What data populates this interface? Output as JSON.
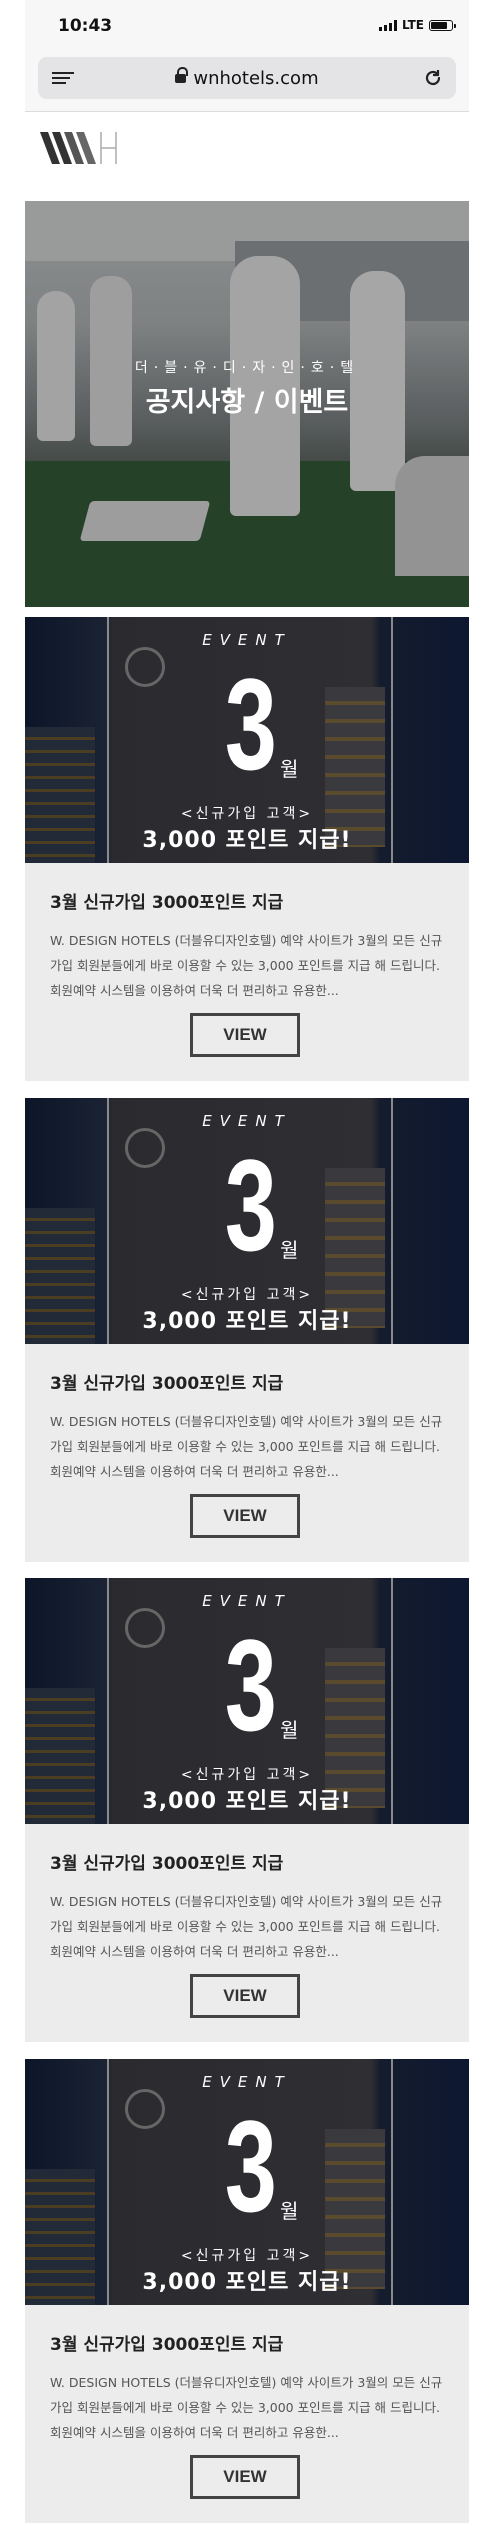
{
  "status_bar": {
    "time": "10:43",
    "network": "LTE"
  },
  "browser": {
    "url": "wnhotels.com"
  },
  "hero": {
    "subtitle": "더·블·유·디·자·인·호·텔",
    "title": "공지사항 / 이벤트"
  },
  "cards": [
    {
      "banner_event": "EVENT",
      "banner_number": "3",
      "banner_month": "월",
      "banner_sub": "<신규가입 고객>",
      "banner_main": "3,000 포인트 지급!",
      "title": "3월 신규가입 3000포인트 지급",
      "description": "W. DESIGN HOTELS (더블유디자인호텔) 예약 사이트가 3월의 모든 신규가입 회원분들에게 바로 이용할 수 있는 3,000 포인트를 지급 해 드립니다. 회원예약 시스템을 이용하여 더욱 더 편리하고 유용한...",
      "button": "VIEW"
    },
    {
      "banner_event": "EVENT",
      "banner_number": "3",
      "banner_month": "월",
      "banner_sub": "<신규가입 고객>",
      "banner_main": "3,000 포인트 지급!",
      "title": "3월 신규가입 3000포인트 지급",
      "description": "W. DESIGN HOTELS (더블유디자인호텔) 예약 사이트가 3월의 모든 신규가입 회원분들에게 바로 이용할 수 있는 3,000 포인트를 지급 해 드립니다. 회원예약 시스템을 이용하여 더욱 더 편리하고 유용한...",
      "button": "VIEW"
    },
    {
      "banner_event": "EVENT",
      "banner_number": "3",
      "banner_month": "월",
      "banner_sub": "<신규가입 고객>",
      "banner_main": "3,000 포인트 지급!",
      "title": "3월 신규가입 3000포인트 지급",
      "description": "W. DESIGN HOTELS (더블유디자인호텔) 예약 사이트가 3월의 모든 신규가입 회원분들에게 바로 이용할 수 있는 3,000 포인트를 지급 해 드립니다. 회원예약 시스템을 이용하여 더욱 더 편리하고 유용한...",
      "button": "VIEW"
    },
    {
      "banner_event": "EVENT",
      "banner_number": "3",
      "banner_month": "월",
      "banner_sub": "<신규가입 고객>",
      "banner_main": "3,000 포인트 지급!",
      "title": "3월 신규가입 3000포인트 지급",
      "description": "W. DESIGN HOTELS (더블유디자인호텔) 예약 사이트가 3월의 모든 신규가입 회원분들에게 바로 이용할 수 있는 3,000 포인트를 지급 해 드립니다. 회원예약 시스템을 이용하여 더욱 더 편리하고 유용한...",
      "button": "VIEW"
    }
  ]
}
